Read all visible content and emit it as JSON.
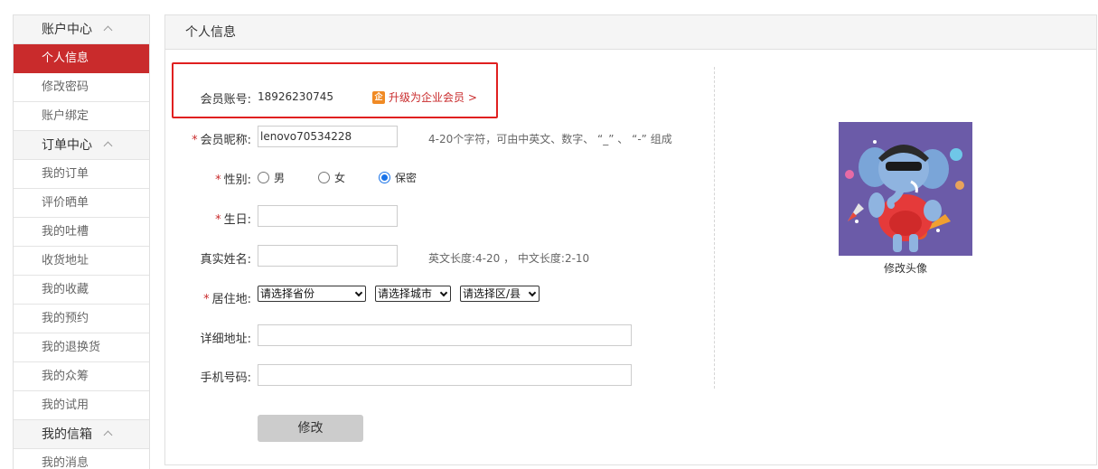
{
  "sidebar": {
    "items": [
      {
        "label": "账户中心",
        "group": true
      },
      {
        "label": "个人信息",
        "active": true
      },
      {
        "label": "修改密码"
      },
      {
        "label": "账户绑定"
      },
      {
        "label": "订单中心",
        "group": true
      },
      {
        "label": "我的订单"
      },
      {
        "label": "评价晒单"
      },
      {
        "label": "我的吐槽"
      },
      {
        "label": "收货地址"
      },
      {
        "label": "我的收藏"
      },
      {
        "label": "我的预约"
      },
      {
        "label": "我的退换货"
      },
      {
        "label": "我的众筹"
      },
      {
        "label": "我的试用"
      },
      {
        "label": "我的信箱",
        "group": true
      },
      {
        "label": "我的消息"
      }
    ]
  },
  "main": {
    "title": "个人信息",
    "account_label": "会员账号:",
    "account_value": "18926230745",
    "upgrade_icon": "企",
    "upgrade_label": "升级为企业会员 >",
    "nickname_label": "会员昵称:",
    "nickname_value": "lenovo70534228",
    "nickname_hint": "4-20个字符，可由中英文、数字、 “_” 、 “-” 组成",
    "gender_label": "性别:",
    "gender_options": [
      "男",
      "女",
      "保密"
    ],
    "gender_selected": "保密",
    "birthday_label": "生日:",
    "birthday_value": "",
    "realname_label": "真实姓名:",
    "realname_value": "",
    "realname_hint": "英文长度:4-20 ， 中文长度:2-10",
    "residence_label": "居住地:",
    "province_selected": "请选择省份",
    "city_selected": "请选择城市",
    "district_selected": "请选择区/县",
    "address_label": "详细地址:",
    "address_value": "",
    "phone_label": "手机号码:",
    "phone_value": "",
    "submit_label": "修改",
    "avatar_caption": "修改头像"
  },
  "colors": {
    "accent_red": "#c92b2c",
    "highlight_border": "#e02020",
    "radio_blue": "#1a73e8",
    "avatar_bg": "#6b5ba8"
  }
}
